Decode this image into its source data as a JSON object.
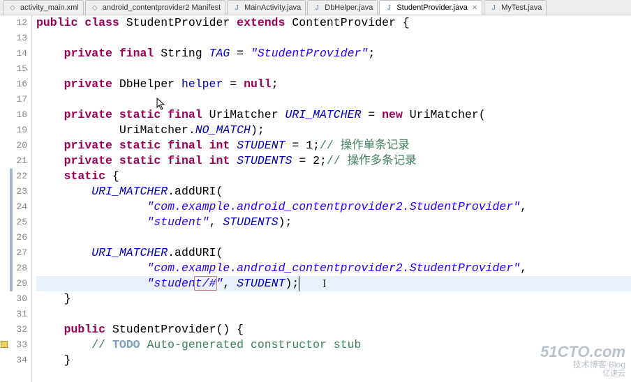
{
  "tabs": [
    {
      "label": "activity_main.xml",
      "active": false,
      "type": "xml"
    },
    {
      "label": "android_contentprovider2 Manifest",
      "active": false,
      "type": "xml"
    },
    {
      "label": "MainActivity.java",
      "active": false,
      "type": "java"
    },
    {
      "label": "DbHelper.java",
      "active": false,
      "type": "java"
    },
    {
      "label": "StudentProvider.java",
      "active": true,
      "type": "java"
    },
    {
      "label": "MyTest.java",
      "active": false,
      "type": "java"
    }
  ],
  "gutter": {
    "start": 12,
    "count": 23,
    "changed_lines": [
      22,
      23,
      24,
      25,
      26,
      27,
      28,
      29
    ],
    "warning_lines": [
      33
    ]
  },
  "code": {
    "lines": [
      {
        "n": 12,
        "html": "<span class='kw'>public</span> <span class='kw'>class</span> StudentProvider <span class='kw'>extends</span> ContentProvider {"
      },
      {
        "n": 13,
        "html": ""
      },
      {
        "n": 14,
        "html": "    <span class='kw'>private</span> <span class='kw'>final</span> String <span class='field-s'>TAG</span> = <span class='str'>\"StudentProvider\"</span>;"
      },
      {
        "n": 15,
        "html": ""
      },
      {
        "n": 16,
        "html": "    <span class='kw'>private</span> DbHelper <span class='field'>helper</span> = <span class='kw'>null</span>;"
      },
      {
        "n": 17,
        "html": ""
      },
      {
        "n": 18,
        "html": "    <span class='kw'>private</span> <span class='kw'>static</span> <span class='kw'>final</span> UriMatcher <span class='field-s'>URI_MATCHER</span> = <span class='kw'>new</span> UriMatcher("
      },
      {
        "n": 19,
        "html": "            UriMatcher.<span class='cnst'>NO_MATCH</span>);"
      },
      {
        "n": 20,
        "html": "    <span class='kw'>private</span> <span class='kw'>static</span> <span class='kw'>final</span> <span class='kw'>int</span> <span class='field-s'>STUDENT</span> = 1;<span class='cm'>// 操作单条记录</span>"
      },
      {
        "n": 21,
        "html": "    <span class='kw'>private</span> <span class='kw'>static</span> <span class='kw'>final</span> <span class='kw'>int</span> <span class='field-s'>STUDENTS</span> = 2;<span class='cm'>// 操作多条记录</span>"
      },
      {
        "n": 22,
        "html": "    <span class='kw'>static</span> {"
      },
      {
        "n": 23,
        "html": "        <span class='field-s'>URI_MATCHER</span>.addURI("
      },
      {
        "n": 24,
        "html": "                <span class='str'>\"com.example.android_contentprovider2.StudentProvider\"</span>,"
      },
      {
        "n": 25,
        "html": "                <span class='str'>\"student\"</span>, <span class='field-s'>STUDENTS</span>);"
      },
      {
        "n": 26,
        "html": ""
      },
      {
        "n": 27,
        "html": "        <span class='field-s'>URI_MATCHER</span>.addURI("
      },
      {
        "n": 28,
        "html": "                <span class='str'>\"com.example.android_contentprovider2.StudentProvider\"</span>,"
      },
      {
        "n": 29,
        "html": "                <span class='str'>\"studen<span class='box-hl'>t/#</span>\"</span>, <span class='field-s'>STUDENT</span>);<span class='cursor'></span><span class='text-cursor-mark'>I</span>",
        "current": true
      },
      {
        "n": 30,
        "html": "    }"
      },
      {
        "n": 31,
        "html": ""
      },
      {
        "n": 32,
        "html": "    <span class='kw'>public</span> StudentProvider() {"
      },
      {
        "n": 33,
        "html": "        <span class='cm'>// </span><span class='todo'>TODO</span><span class='cm'> Auto-generated constructor stub</span>"
      },
      {
        "n": 34,
        "html": "    }"
      }
    ]
  },
  "watermark": {
    "line1": "51CTO.com",
    "line2": "技术博客  Blog",
    "line3": "亿速云"
  }
}
